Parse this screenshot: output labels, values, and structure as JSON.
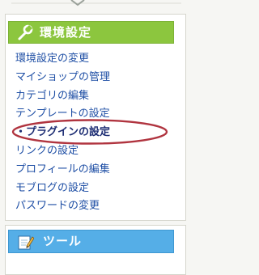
{
  "settings_panel": {
    "title": "環境設定",
    "title_icon": "wrench-icon",
    "header_color": "#8cc63e",
    "items": [
      {
        "label": "環境設定の変更",
        "current": false
      },
      {
        "label": "マイショップの管理",
        "current": false
      },
      {
        "label": "カテゴリの編集",
        "current": false
      },
      {
        "label": "テンプレートの設定",
        "current": false
      },
      {
        "label": "・プラグインの設定",
        "current": true
      },
      {
        "label": "リンクの設定",
        "current": false
      },
      {
        "label": "プロフィールの編集",
        "current": false
      },
      {
        "label": "モブログの設定",
        "current": false
      },
      {
        "label": "パスワードの変更",
        "current": false
      }
    ],
    "highlight_color": "#b0343f"
  },
  "tools_panel": {
    "title": "ツール",
    "title_icon": "notepad-pencil-icon",
    "header_color": "#55aee7"
  }
}
